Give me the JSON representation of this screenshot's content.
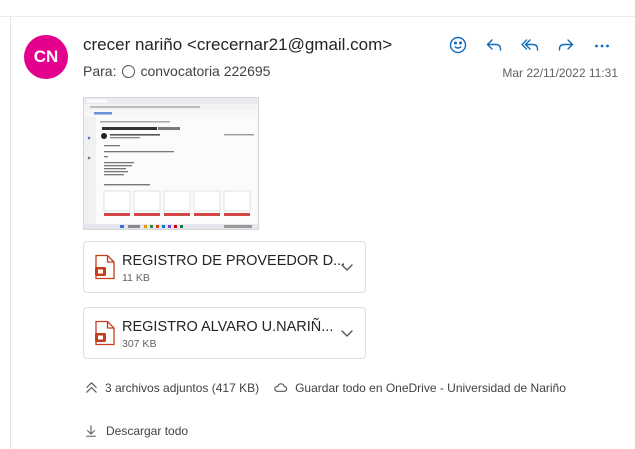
{
  "message": {
    "avatar_initials": "CN",
    "avatar_color": "#e3008c",
    "sender": "crecer nariño <crecernar21@gmail.com>",
    "to_label": "Para:",
    "to_recipient": "convocatoria 222695",
    "date": "Mar 22/11/2022 11:31"
  },
  "actions": [
    {
      "icon": "emoji-icon"
    },
    {
      "icon": "reply-icon"
    },
    {
      "icon": "reply-all-icon"
    },
    {
      "icon": "forward-icon"
    },
    {
      "icon": "more-icon"
    }
  ],
  "attachments": [
    {
      "name": "REGISTRO DE PROVEEDOR D...",
      "size": "11 KB"
    },
    {
      "name": "REGISTRO ALVARO U.NARIÑ...",
      "size": "307 KB"
    }
  ],
  "summary": {
    "count_text": "3 archivos adjuntos (417 KB)",
    "save_text": "Guardar todo en OneDrive - Universidad de Nariño"
  },
  "download_all": "Descargar todo",
  "accent_color": "#0f6cbd",
  "file_icon_color": "#c43e1c"
}
